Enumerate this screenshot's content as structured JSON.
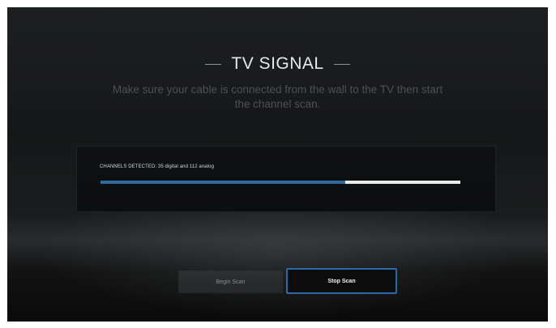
{
  "header": {
    "title": "TV SIGNAL",
    "subtitle": "Make sure your cable is connected from the wall to the TV then start the channel scan."
  },
  "scan": {
    "status": "CHANNELS DETECTED: 35 digital and 112 analog",
    "progress": 0.68
  },
  "buttons": {
    "begin_label": "Begin Scan",
    "stop_label": "Stop Scan"
  },
  "colors": {
    "accent": "#2f6aa3",
    "track": "#e9eaea",
    "background": "#161718"
  }
}
